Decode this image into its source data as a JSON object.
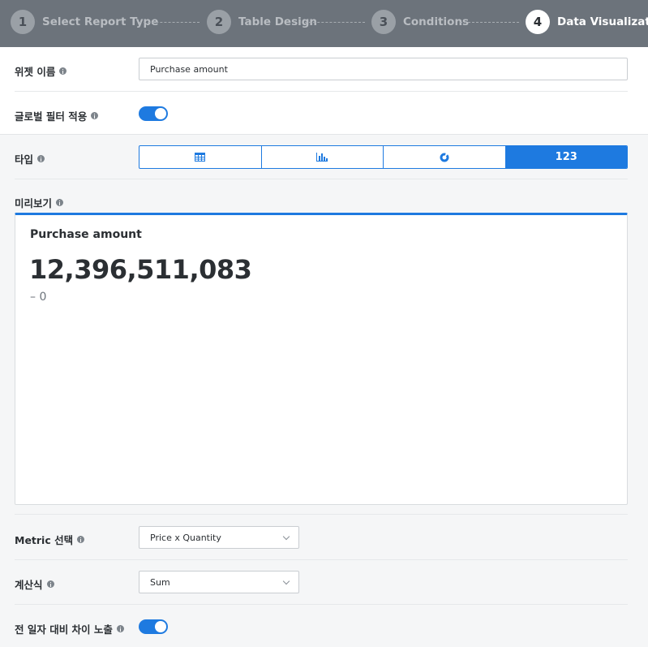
{
  "stepper": {
    "steps": [
      {
        "number": "1",
        "label": "Select Report Type"
      },
      {
        "number": "2",
        "label": "Table Design"
      },
      {
        "number": "3",
        "label": "Conditions"
      },
      {
        "number": "4",
        "label": "Data Visualization"
      }
    ],
    "active_step": "4"
  },
  "form": {
    "widget_name_label": "위젯 이름",
    "widget_name_value": "Purchase amount",
    "global_filter_label": "글로벌 필터 적용",
    "global_filter_on": true,
    "type_label": "타입",
    "type_tabs": [
      {
        "icon": "table-icon"
      },
      {
        "icon": "bar-chart-icon"
      },
      {
        "icon": "donut-chart-icon"
      },
      {
        "label": "123",
        "active": true
      }
    ],
    "preview_label": "미리보기",
    "metric_label": "Metric 선택",
    "metric_value": "Price x Quantity",
    "formula_label": "계산식",
    "formula_value": "Sum",
    "compare_label": "전 일자 대비 차이 노출",
    "compare_on": true
  },
  "preview": {
    "title": "Purchase amount",
    "value": "12,396,511,083",
    "delta": "– 0"
  },
  "colors": {
    "accent": "#1e7ae0",
    "header_bg": "#6c737b"
  }
}
